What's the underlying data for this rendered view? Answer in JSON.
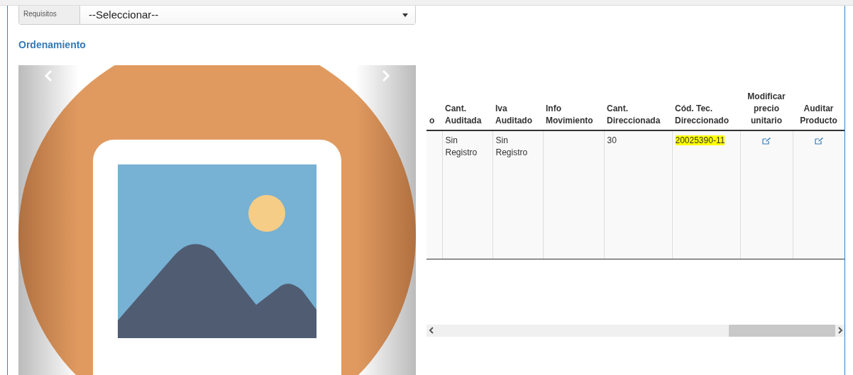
{
  "form": {
    "label": "Requisitos",
    "value": "--Seleccionar--"
  },
  "section_title": "Ordenamiento",
  "table": {
    "columns": [
      {
        "label": "o",
        "kind": "data"
      },
      {
        "label": "Cant. Auditada",
        "kind": "data"
      },
      {
        "label": "Iva Auditado",
        "kind": "data"
      },
      {
        "label": "Info Movimiento",
        "kind": "data"
      },
      {
        "label": "Cant. Direccionada",
        "kind": "data"
      },
      {
        "label": "Cód. Tec. Direccionado",
        "kind": "data"
      },
      {
        "label": "Modificar precio unitario",
        "kind": "action"
      },
      {
        "label": "Auditar Producto",
        "kind": "action"
      }
    ],
    "rows": [
      {
        "cells": [
          {
            "kind": "blank"
          },
          {
            "kind": "text",
            "text": "Sin Registro",
            "highlighted": false
          },
          {
            "kind": "text",
            "text": "Sin Registro",
            "highlighted": false
          },
          {
            "kind": "blank"
          },
          {
            "kind": "text",
            "text": "30",
            "highlighted": false
          },
          {
            "kind": "text",
            "text": "20025390-11",
            "highlighted": true
          },
          {
            "kind": "edit"
          },
          {
            "kind": "edit"
          }
        ]
      }
    ]
  }
}
